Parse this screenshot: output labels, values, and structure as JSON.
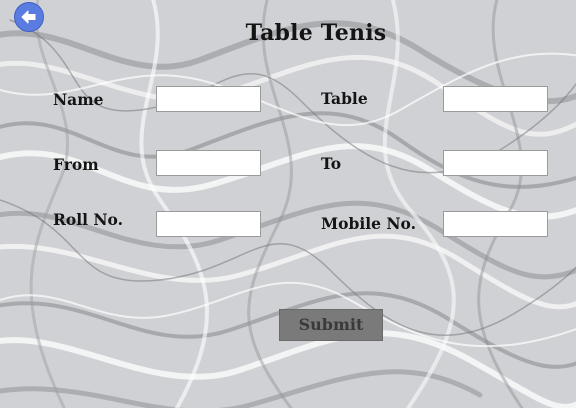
{
  "form": {
    "title": "Table Tenis",
    "fields": {
      "name": {
        "label": "Name",
        "value": ""
      },
      "table": {
        "label": "Table",
        "value": ""
      },
      "from": {
        "label": "From",
        "value": ""
      },
      "to": {
        "label": "To",
        "value": ""
      },
      "roll_no": {
        "label": "Roll No.",
        "value": ""
      },
      "mobile_no": {
        "label": "Mobile No.",
        "value": ""
      }
    },
    "submit_label": "Submit"
  },
  "nav": {
    "back_icon": "back-arrow-icon"
  },
  "colors": {
    "back_button": "#5a7be0",
    "submit_button": "#7a7a7a",
    "background": "#cfd1d4"
  }
}
